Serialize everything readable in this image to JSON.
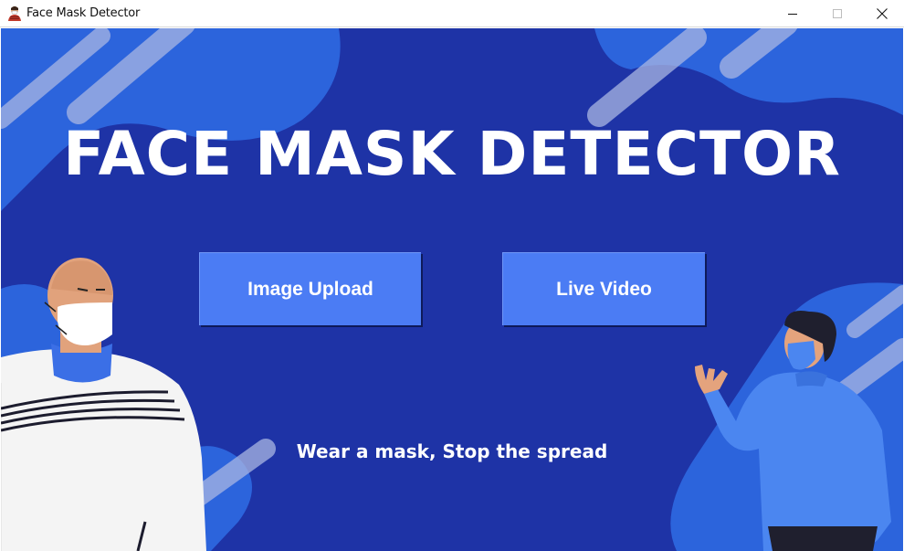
{
  "window": {
    "title": "Face Mask Detector",
    "icon": "masked-person-icon",
    "controls": [
      "minimize-icon",
      "maximize-icon",
      "close-icon"
    ]
  },
  "main": {
    "headline": "FACE MASK DETECTOR",
    "buttons": {
      "image_upload": "Image Upload",
      "live_video": "Live Video"
    },
    "tagline": "Wear a mask, Stop the spread"
  },
  "colors": {
    "background": "#1e33a6",
    "button": "#4b7cf4",
    "text": "#ffffff",
    "accent_blobs": "#2d6fe0"
  }
}
